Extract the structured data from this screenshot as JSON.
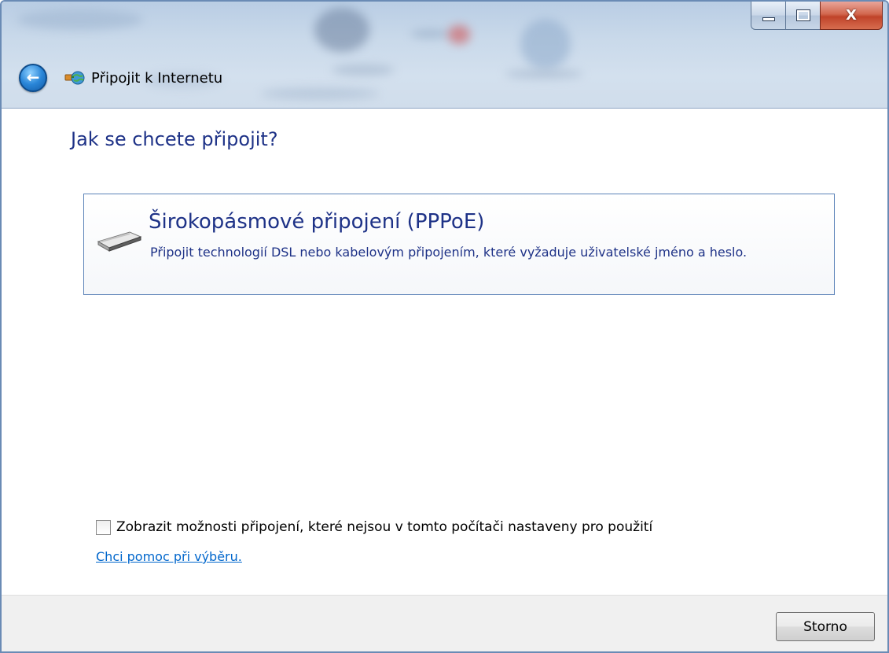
{
  "window": {
    "title": "Připojit k Internetu",
    "caption_buttons": {
      "minimize_icon": "minimize-icon",
      "maximize_icon": "maximize-icon",
      "close_icon": "close-icon",
      "close_glyph": "X"
    }
  },
  "nav": {
    "back_icon": "back-arrow-icon",
    "back_glyph": "←"
  },
  "content": {
    "question": "Jak se chcete připojit?",
    "option": {
      "icon": "broadband-modem-icon",
      "title": "Širokopásmové připojení (PPPoE)",
      "description": "Připojit technologií DSL nebo kabelovým připojením, které vyžaduje uživatelské jméno a heslo."
    },
    "show_options_checkbox": {
      "label": "Zobrazit možnosti připojení, které nejsou v tomto počítači nastaveny pro použití",
      "checked": false
    },
    "help_link": "Chci pomoc při výběru."
  },
  "footer": {
    "cancel_label": "Storno"
  },
  "colors": {
    "heading_blue": "#1e3287",
    "link_blue": "#0066cc",
    "card_border": "#5b82b8",
    "footer_bg": "#f0f0f0",
    "close_red": "#c0432a"
  }
}
